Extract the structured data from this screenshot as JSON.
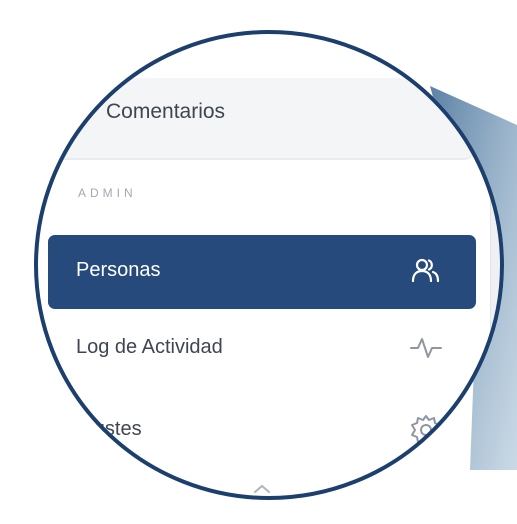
{
  "sidebar": {
    "comments_label": "Comentarios",
    "section_label": "ADMIN",
    "items": [
      {
        "label": "Personas",
        "icon": "users-icon",
        "active": true
      },
      {
        "label": "Log de Actividad",
        "icon": "activity-icon",
        "active": false
      },
      {
        "label": "Ajustes",
        "icon": "gear-icon",
        "active": false
      }
    ]
  },
  "colors": {
    "accent": "#264a7c",
    "ring": "#1c3f6e",
    "beam": "#5c84a8"
  }
}
